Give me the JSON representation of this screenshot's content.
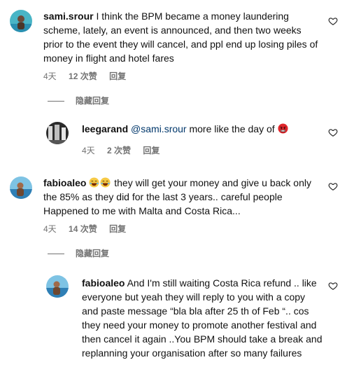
{
  "comments": [
    {
      "username": "sami.srour",
      "text": "I think the BPM became a money laundering scheme, lately, an event is announced, and then two weeks prior to the event they will cancel, and ppl end up losing piles of money in flight and hotel fares",
      "time": "4天",
      "likes": "12 次赞",
      "reply_label": "回复",
      "hide_replies_label": "隐藏回复"
    },
    {
      "username": "leegarand",
      "mention": "@sami.srour",
      "text": "more like the day of",
      "time": "4天",
      "likes": "2 次赞",
      "reply_label": "回复"
    },
    {
      "username": "fabioaleo",
      "text": "they will get your money and give u back only the 85% as they did for the last 3 years.. careful people Happened to me with Malta and Costa Rica...",
      "time": "4天",
      "likes": "14 次赞",
      "reply_label": "回复",
      "hide_replies_label": "隐藏回复"
    },
    {
      "username": "fabioaleo",
      "text": "And I'm still waiting Costa Rica refund .. like everyone but yeah they will reply to you with a copy and paste message “bla bla after 25 th of Feb “.. cos they need your money to promote another festival and then cancel it again ..You BPM should take a break and replanning your organisation after so many failures"
    }
  ],
  "icons": {
    "heart": "heart-outline-icon",
    "angry": "angry-face-emoji",
    "laugh": "laughing-face-emoji"
  },
  "colors": {
    "meta_text": "#737373",
    "mention": "#00376b",
    "angry_emoji": "#e0262b",
    "laugh_emoji": "#f6c945"
  }
}
